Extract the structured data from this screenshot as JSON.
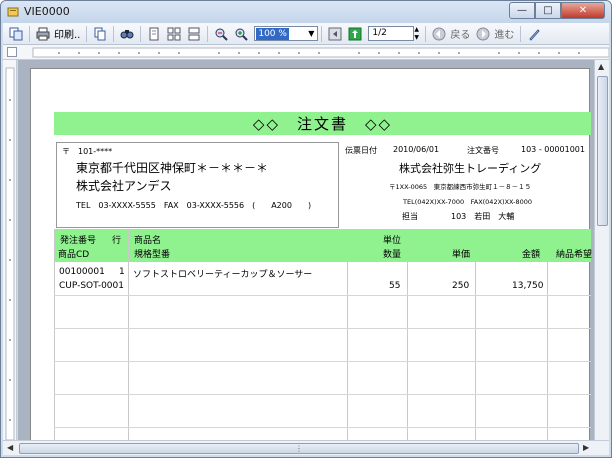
{
  "window": {
    "title": "VIE0000",
    "minimize_glyph": "—",
    "maximize_glyph": "□",
    "close_glyph": "✕"
  },
  "toolbar": {
    "print_label": "印刷..",
    "zoom_value": "100 %",
    "page_value": "1/2",
    "back_label": "戻る",
    "forward_label": "進む"
  },
  "document": {
    "title": "◇◇　注文書　◇◇",
    "customer": {
      "postal": "〒　101-****",
      "address": "東京都千代田区神保町＊－＊＊－＊",
      "company": "株式会社アンデス",
      "tel_fax": "TEL　03-XXXX-5555　FAX　03-XXXX-5556　(　　A200　　)"
    },
    "slip_date_label": "伝票日付",
    "slip_date": "2010/06/01",
    "order_no_label": "注文番号",
    "order_no": "103 - 00001001",
    "seller": {
      "company": "株式会社弥生トレーディング",
      "address": "〒1XX-0065　東京都練西市弥生町１－８－１５",
      "tel_fax": "TEL(042X)XX-7000　FAX(042X)XX-8000",
      "rep_label": "担当",
      "rep": "103　若田　大輔"
    },
    "table_headers": {
      "order_no": "発注番号",
      "line": "行",
      "product_cd": "商品CD",
      "product_name": "商品名",
      "spec": "規格型番",
      "unit": "単位",
      "qty": "数量",
      "price": "単価",
      "amount": "金額",
      "delivery": "納品希望"
    },
    "rows": [
      {
        "order_no": "00100001",
        "line": "1",
        "product_cd": "CUP-SOT-0001",
        "product_name": "ソフトストロベリーティーカップ＆ソーサー",
        "spec": "",
        "unit": "",
        "qty": "55",
        "price": "250",
        "amount": "13,750"
      }
    ]
  }
}
